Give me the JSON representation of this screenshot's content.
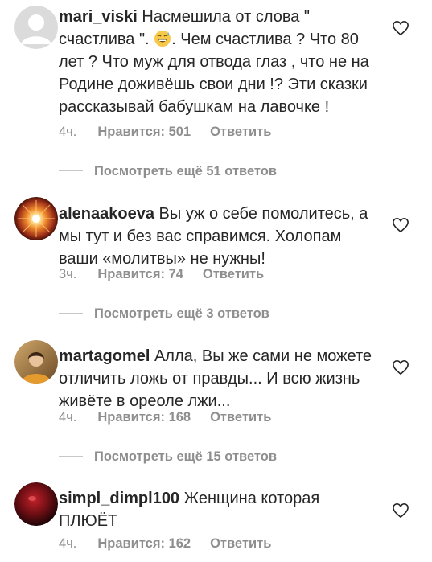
{
  "comments": [
    {
      "username": "mari_viski",
      "text": "Насмешила от слова \" счастлива \". ",
      "text_after_emoji": ". Чем счастлива ? Что 80 лет ? Что муж для отвода глаз , что не на Родине доживёшь свои дни !? Эти сказки рассказывай бабушкам на лавочке !",
      "emoji": "grinning-sweat-emoji",
      "time": "4ч.",
      "likes": "Нравится: 501",
      "reply": "Ответить",
      "avatar": "default-avatar-icon",
      "view_replies": "Посмотреть ещё 51 ответов"
    },
    {
      "username": "alenaakoeva",
      "text": "Вы уж о себе помолитесь, а мы тут и без вас справимся. Холопам ваши «молитвы» не нужны!",
      "time": "3ч.",
      "likes": "Нравится: 74",
      "reply": "Ответить",
      "avatar": "sunburst-avatar",
      "view_replies": "Посмотреть ещё 3 ответов"
    },
    {
      "username": "martagomel",
      "text": "Алла, Вы же сами не можете отличить ложь от правды... И всю жизнь живёте в ореоле лжи...",
      "time": "4ч.",
      "likes": "Нравится: 168",
      "reply": "Ответить",
      "avatar": "photo-avatar",
      "view_replies": "Посмотреть ещё 15 ответов"
    },
    {
      "username": "simpl_dimpl100",
      "text": "Женщина которая ПЛЮЁТ",
      "time": "4ч.",
      "likes": "Нравится: 162",
      "reply": "Ответить",
      "avatar": "dark-red-avatar"
    }
  ],
  "icons": {
    "like": "heart-outline-icon"
  },
  "colors": {
    "text": "#262626",
    "secondary": "#8e8e8e",
    "divider": "#c7c7c7"
  }
}
